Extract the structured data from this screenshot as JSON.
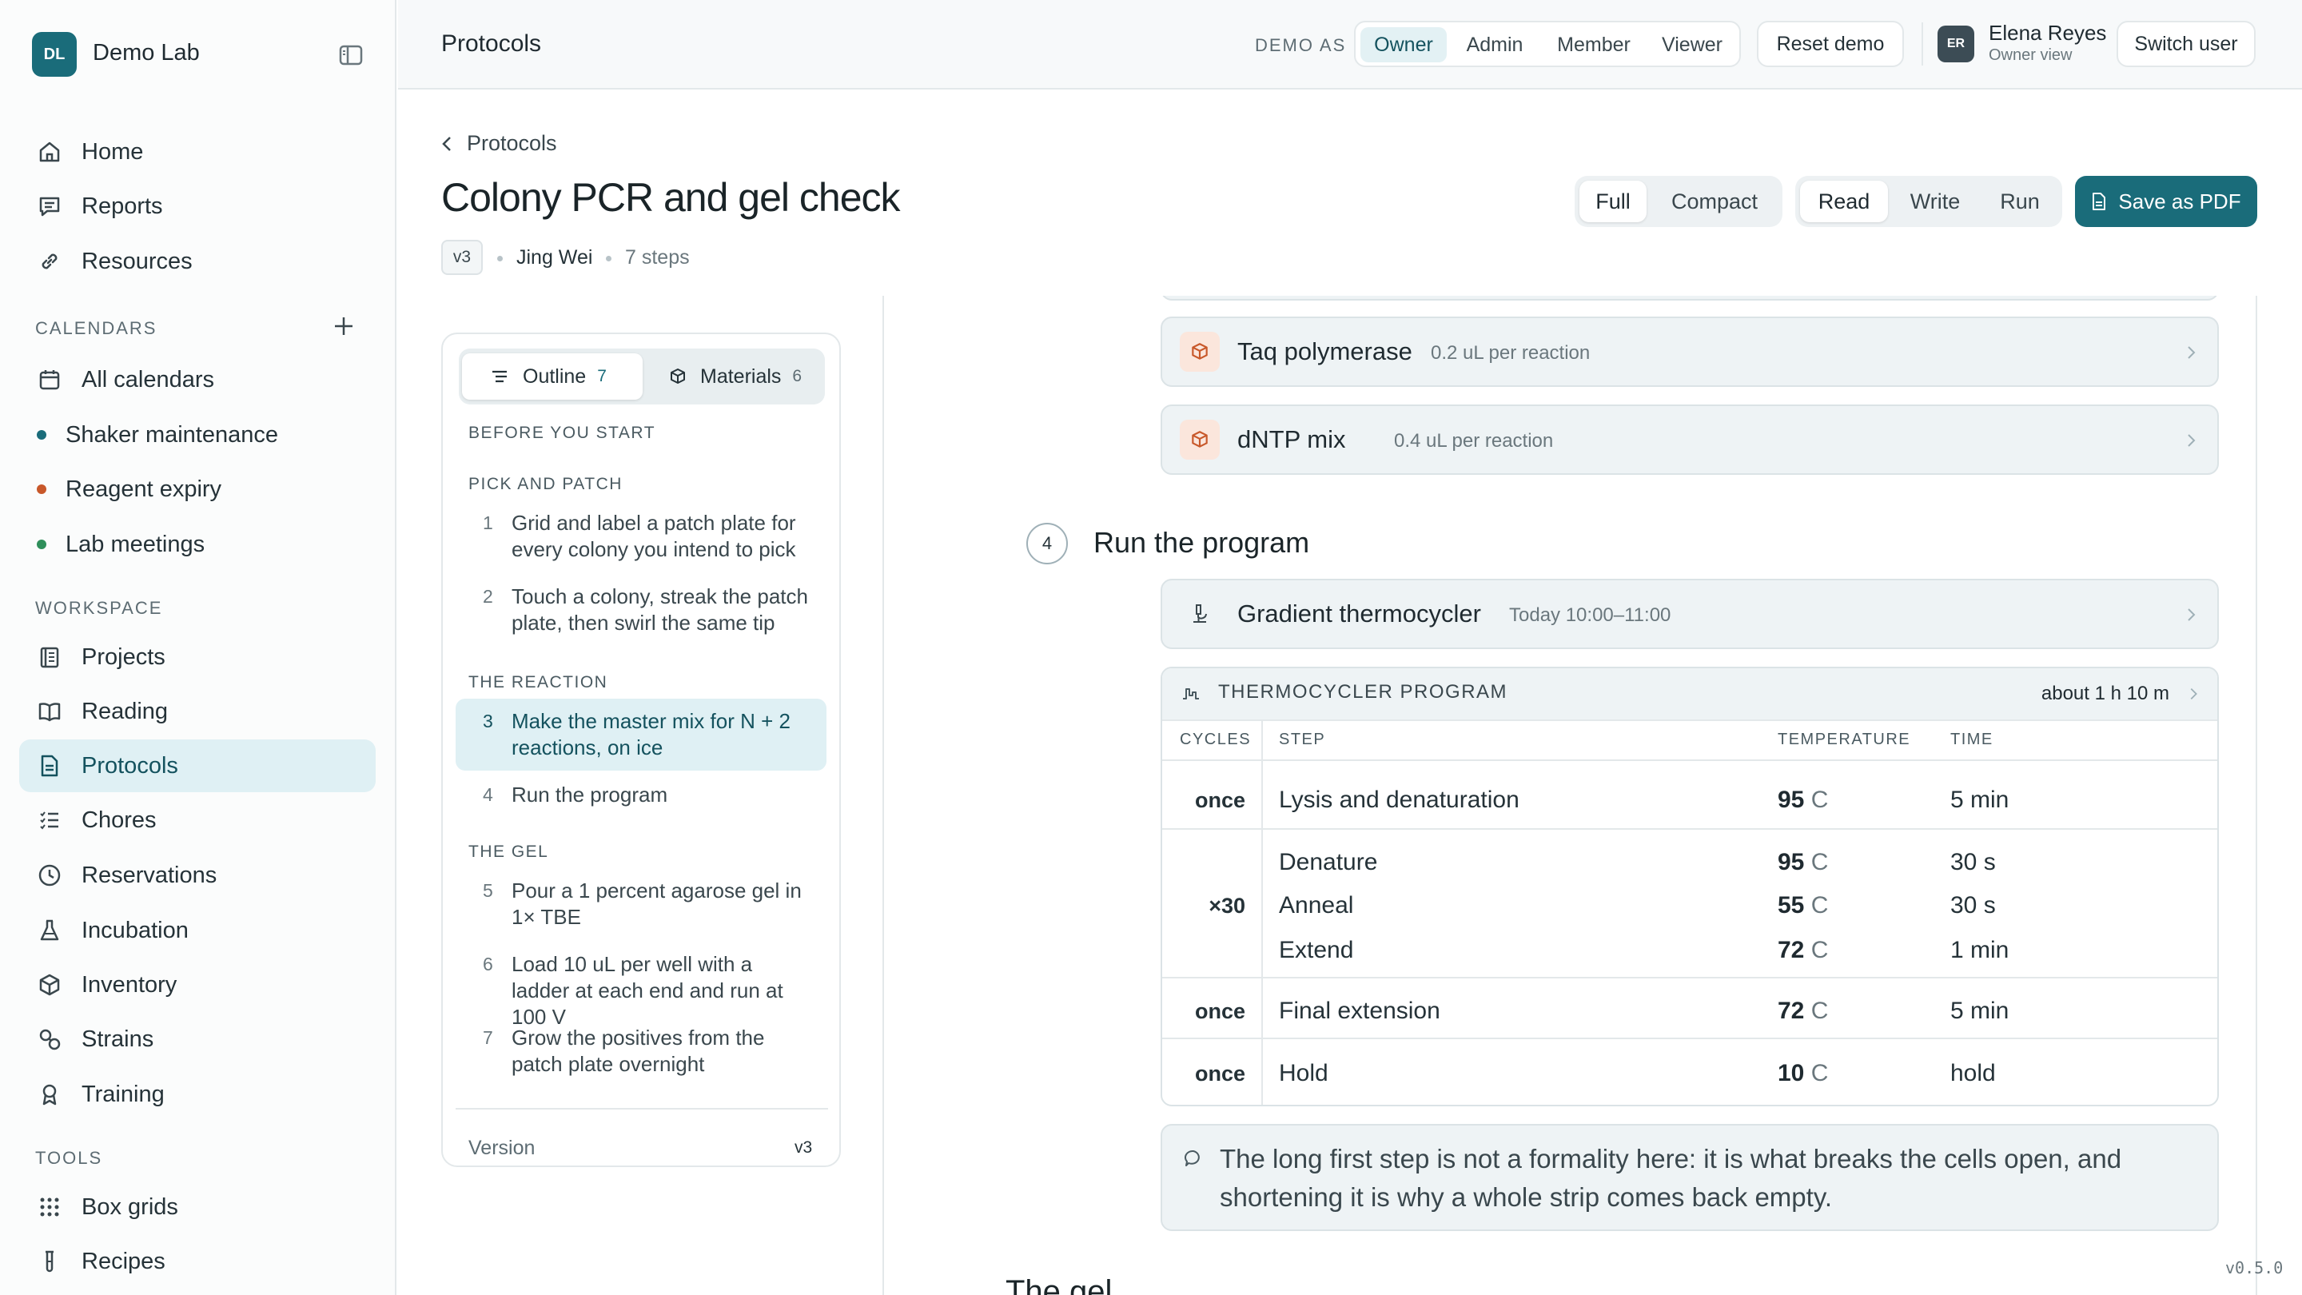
{
  "app": {
    "name": "Demo Lab",
    "badge": "DL",
    "build": "v0.5.0"
  },
  "colors": {
    "accent": "#1a6c7a",
    "active_bg": "#dff0f4",
    "shaker": "#1a6c7a",
    "reagent": "#c8582a",
    "meetings": "#2f8f5b",
    "material_icon": "#c8582a"
  },
  "sidebar": {
    "items": [
      {
        "label": "Home",
        "icon": "home-icon"
      },
      {
        "label": "Reports",
        "icon": "chat-icon"
      },
      {
        "label": "Resources",
        "icon": "link-icon"
      }
    ],
    "calendars_title": "CALENDARS",
    "calendars": [
      {
        "label": "All calendars",
        "icon": "calendar-icon"
      },
      {
        "label": "Shaker maintenance"
      },
      {
        "label": "Reagent expiry"
      },
      {
        "label": "Lab meetings"
      }
    ],
    "workspace_title": "WORKSPACE",
    "workspace": [
      {
        "label": "Projects",
        "icon": "notebook-icon"
      },
      {
        "label": "Reading",
        "icon": "book-icon"
      },
      {
        "label": "Protocols",
        "icon": "document-icon",
        "active": true
      },
      {
        "label": "Chores",
        "icon": "checklist-icon"
      },
      {
        "label": "Reservations",
        "icon": "clock-icon"
      },
      {
        "label": "Incubation",
        "icon": "flask-icon"
      },
      {
        "label": "Inventory",
        "icon": "box-icon"
      },
      {
        "label": "Strains",
        "icon": "strains-icon"
      },
      {
        "label": "Training",
        "icon": "award-icon"
      }
    ],
    "tools_title": "TOOLS",
    "tools": [
      {
        "label": "Box grids",
        "icon": "grid-icon"
      },
      {
        "label": "Recipes",
        "icon": "test-tube-icon"
      }
    ]
  },
  "topbar": {
    "title": "Protocols",
    "demo_as": "DEMO AS",
    "roles": [
      "Owner",
      "Admin",
      "Member",
      "Viewer"
    ],
    "active_role": "Owner",
    "reset": "Reset demo",
    "user": {
      "initials": "ER",
      "name": "Elena Reyes",
      "role": "Owner view"
    },
    "switch_user": "Switch user"
  },
  "header": {
    "breadcrumb": "Protocols",
    "title": "Colony PCR and gel check",
    "version": "v3",
    "author": "Jing Wei",
    "steps": "7 steps",
    "density": [
      "Full",
      "Compact"
    ],
    "active_density": "Full",
    "modes": [
      "Read",
      "Write",
      "Run"
    ],
    "active_mode": "Read",
    "save_pdf": "Save as PDF"
  },
  "outline": {
    "tabs": [
      {
        "label": "Outline",
        "count": "7",
        "icon": "list-icon"
      },
      {
        "label": "Materials",
        "count": "6",
        "icon": "box-icon"
      }
    ],
    "before": "BEFORE YOU START",
    "sections": [
      {
        "title": "PICK AND PATCH",
        "items": [
          {
            "n": "1",
            "text": "Grid and label a patch plate for every colony you intend to pick"
          },
          {
            "n": "2",
            "text": "Touch a colony, streak the patch plate, then swirl the same tip in…"
          }
        ]
      },
      {
        "title": "THE REACTION",
        "items": [
          {
            "n": "3",
            "text": "Make the master mix for N + 2 reactions, on ice",
            "active": true
          },
          {
            "n": "4",
            "text": "Run the program"
          }
        ]
      },
      {
        "title": "THE GEL",
        "items": [
          {
            "n": "5",
            "text": "Pour a 1 percent agarose gel in 1× TBE"
          },
          {
            "n": "6",
            "text": "Load 10 uL per well with a ladder at each end and run at 100 V"
          },
          {
            "n": "7",
            "text": "Grow the positives from the patch plate overnight"
          }
        ]
      }
    ],
    "version_label": "Version",
    "version_value": "v3"
  },
  "doc": {
    "materials": [
      {
        "name": "Taq polymerase",
        "note": "0.2 uL per reaction"
      },
      {
        "name": "dNTP mix",
        "note": "0.4 uL per reaction"
      }
    ],
    "step4": {
      "number": "4",
      "title": "Run the program"
    },
    "equipment": {
      "name": "Gradient thermocycler",
      "when": "Today 10:00–11:00"
    },
    "program": {
      "title": "THERMOCYCLER PROGRAM",
      "duration": "about 1 h 10 m",
      "headers": [
        "CYCLES",
        "STEP",
        "TEMPERATURE",
        "TIME"
      ],
      "rows": [
        {
          "cycles": "once",
          "steps": [
            {
              "name": "Lysis and denaturation",
              "temp": "95",
              "unit": "C",
              "time": "5 min"
            }
          ]
        },
        {
          "cycles": "×30",
          "steps": [
            {
              "name": "Denature",
              "temp": "95",
              "unit": "C",
              "time": "30 s"
            },
            {
              "name": "Anneal",
              "temp": "55",
              "unit": "C",
              "time": "30 s"
            },
            {
              "name": "Extend",
              "temp": "72",
              "unit": "C",
              "time": "1 min"
            }
          ]
        },
        {
          "cycles": "once",
          "steps": [
            {
              "name": "Final extension",
              "temp": "72",
              "unit": "C",
              "time": "5 min"
            }
          ]
        },
        {
          "cycles": "once",
          "steps": [
            {
              "name": "Hold",
              "temp": "10",
              "unit": "C",
              "time": "hold"
            }
          ]
        }
      ]
    },
    "note": "The long first step is not a formality here: it is what breaks the cells open, and shortening it is why a whole strip comes back empty.",
    "next_section": "The gel"
  }
}
